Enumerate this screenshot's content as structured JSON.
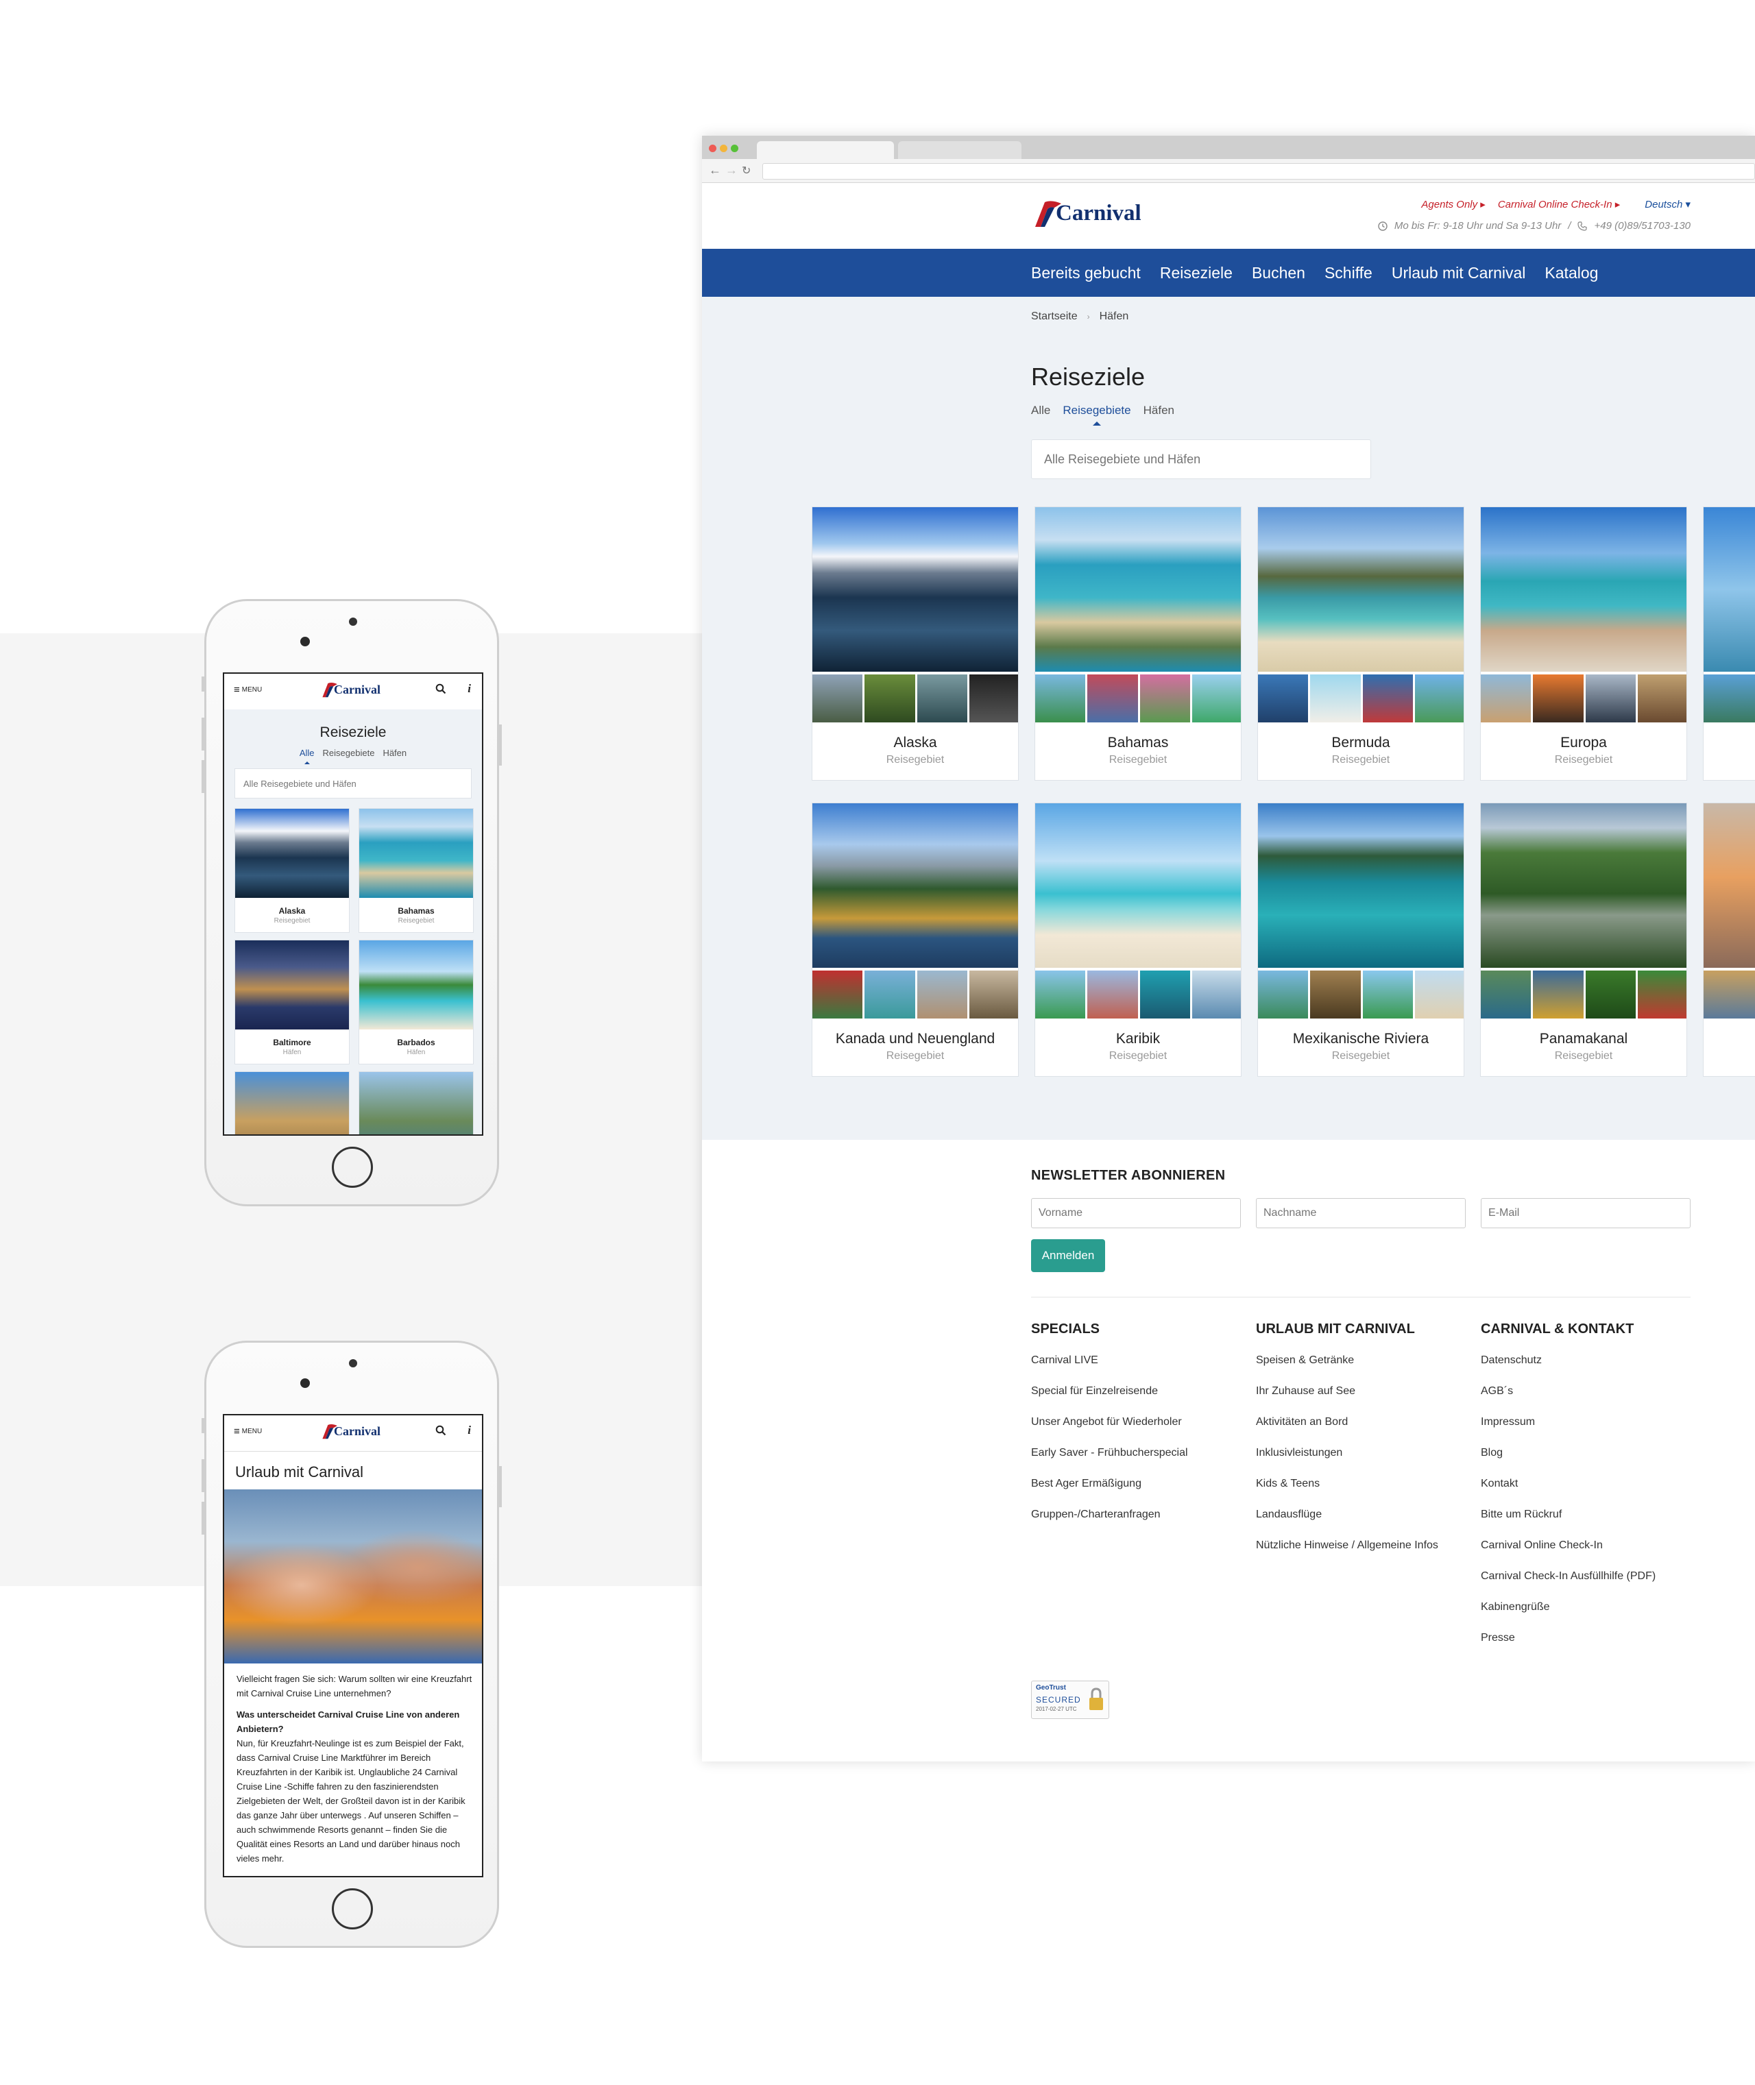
{
  "brand": {
    "name": "Carnival",
    "red": "#c51f28",
    "navy": "#12306f",
    "nav_blue": "#1e4e9a",
    "teal": "#2a9d8f"
  },
  "desktop": {
    "top_links": {
      "agents": "Agents Only ▸",
      "checkin": "Carnival Online Check-In ▸",
      "language": "Deutsch ▾"
    },
    "contact": {
      "clock_icon": "clock-icon",
      "hours": "Mo bis Fr: 9-18 Uhr und Sa 9-13 Uhr",
      "separator": "/",
      "phone_icon": "phone-icon",
      "phone": "+49 (0)89/51703-130"
    },
    "nav": [
      "Bereits gebucht",
      "Reiseziele",
      "Buchen",
      "Schiffe",
      "Urlaub mit Carnival",
      "Katalog"
    ],
    "breadcrumb": {
      "home": "Startseite",
      "separator": "›",
      "current": "Häfen"
    },
    "title": "Reiseziele",
    "tabs": [
      "Alle",
      "Reisegebiete",
      "Häfen"
    ],
    "active_tab": "Reisegebiete",
    "search_placeholder": "Alle Reisegebiete und Häfen",
    "cards": [
      {
        "name": "Alaska",
        "type": "Reisegebiet"
      },
      {
        "name": "Bahamas",
        "type": "Reisegebiet"
      },
      {
        "name": "Bermuda",
        "type": "Reisegebiet"
      },
      {
        "name": "Europa",
        "type": "Reisegebiet"
      },
      {
        "name": "Kanada und Neuengland",
        "type": "Reisegebiet"
      },
      {
        "name": "Karibik",
        "type": "Reisegebiet"
      },
      {
        "name": "Mexikanische Riviera",
        "type": "Reisegebiet"
      },
      {
        "name": "Panamakanal",
        "type": "Reisegebiet"
      }
    ],
    "newsletter": {
      "title": "NEWSLETTER ABONNIEREN",
      "firstname": "Vorname",
      "lastname": "Nachname",
      "email": "E-Mail",
      "submit": "Anmelden"
    },
    "footer": [
      {
        "title": "SPECIALS",
        "links": [
          "Carnival LIVE",
          "Special für Einzelreisende",
          "Unser Angebot für Wiederholer",
          "Early Saver - Frühbucherspecial",
          "Best Ager Ermäßigung",
          "Gruppen-/Charteranfragen"
        ]
      },
      {
        "title": "URLAUB MIT CARNIVAL",
        "links": [
          "Speisen & Getränke",
          "Ihr Zuhause auf See",
          "Aktivitäten an Bord",
          "Inklusivleistungen",
          "Kids & Teens",
          "Landausflüge",
          "Nützliche Hinweise / Allgemeine Infos"
        ]
      },
      {
        "title": "CARNIVAL & KONTAKT",
        "links": [
          "Datenschutz",
          "AGB´s",
          "Impressum",
          "Blog",
          "Kontakt",
          "Bitte um Rückruf",
          "Carnival Online Check-In",
          "Carnival Check-In Ausfüllhilfe (PDF)",
          "Kabinengrüße",
          "Presse"
        ]
      }
    ],
    "badge": {
      "brand": "GeoTrust",
      "status": "SECURED",
      "date": "2017-02-27 UTC"
    }
  },
  "phone1": {
    "menu_label": "MENU",
    "title": "Reiseziele",
    "tabs": [
      "Alle",
      "Reisegebiete",
      "Häfen"
    ],
    "active_tab": "Alle",
    "search_placeholder": "Alle Reisegebiete und Häfen",
    "cards": [
      {
        "name": "Alaska",
        "type": "Reisegebiet"
      },
      {
        "name": "Bahamas",
        "type": "Reisegebiet"
      },
      {
        "name": "Baltimore",
        "type": "Häfen"
      },
      {
        "name": "Barbados",
        "type": "Häfen"
      }
    ]
  },
  "phone2": {
    "menu_label": "MENU",
    "title": "Urlaub mit Carnival",
    "intro": "Vielleicht fragen Sie sich: Warum sollten wir eine Kreuzfahrt mit Carnival Cruise Line unternehmen?",
    "question": "Was unterscheidet Carnival Cruise Line von anderen Anbietern?",
    "body": "Nun, für Kreuzfahrt-Neulinge ist es zum Beispiel der Fakt, dass Carnival Cruise Line Marktführer im Bereich Kreuzfahrten in der Karibik ist. Unglaubliche 24 Carnival Cruise Line -Schiffe fahren zu den faszinierendsten Zielgebieten der Welt, der Großteil davon ist in der Karibik das ganze Jahr über unterwegs . Auf unseren Schiffen – auch schwimmende Resorts genannt – finden Sie die Qualität eines Resorts an Land und darüber hinaus noch vieles mehr."
  }
}
